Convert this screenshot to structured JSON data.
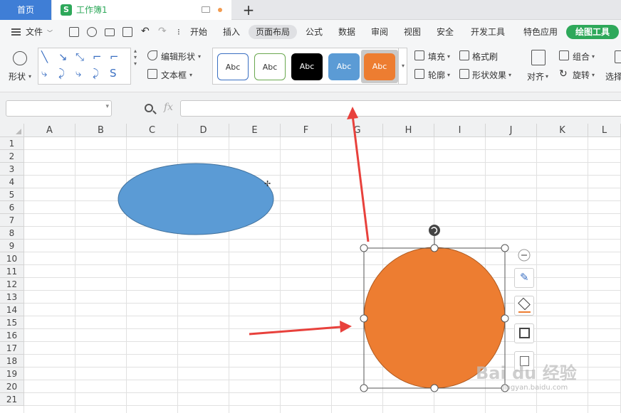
{
  "tabs": {
    "home": "首页",
    "document": "工作簿1"
  },
  "menu": {
    "file": "文件",
    "items": [
      "开始",
      "插入",
      "页面布局",
      "公式",
      "数据",
      "审阅",
      "视图",
      "安全",
      "开发工具",
      "特色应用"
    ],
    "active": "页面布局",
    "drawing_tools": "绘图工具"
  },
  "ribbon": {
    "shape": "形状",
    "edit_shape": "编辑形状",
    "text_box": "文本框",
    "style_label": "Abc",
    "fill": "填充",
    "format_painter": "格式刷",
    "outline": "轮廓",
    "shape_effects": "形状效果",
    "align": "对齐",
    "group": "组合",
    "rotate": "旋转",
    "select": "选择"
  },
  "style_colors": {
    "outline_blue": "#3a6fc2",
    "outline_green": "#6aa84f",
    "black": "#000000",
    "blue": "#5b9bd5",
    "orange": "#ed7d31"
  },
  "formula": {
    "name_box": "",
    "fx": "fx",
    "value": ""
  },
  "columns": [
    "A",
    "B",
    "C",
    "D",
    "E",
    "F",
    "G",
    "H",
    "I",
    "J",
    "K",
    "L"
  ],
  "rows": [
    "1",
    "2",
    "3",
    "4",
    "5",
    "6",
    "7",
    "8",
    "9",
    "10",
    "11",
    "12",
    "13",
    "14",
    "15",
    "16",
    "17",
    "18",
    "19",
    "20",
    "21"
  ],
  "shapes": {
    "ellipse_color": "#5b9bd5",
    "circle_color": "#ed7d31",
    "arrow_color": "#e8413c"
  },
  "watermark": {
    "brand": "Bai du 经验",
    "url": "jingyan.baidu.com"
  }
}
